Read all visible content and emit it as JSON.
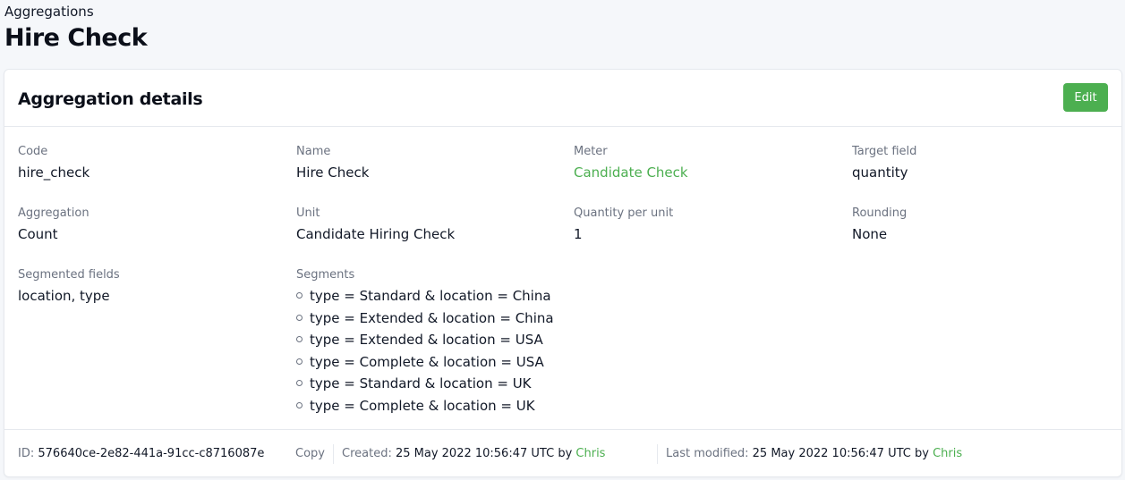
{
  "breadcrumb": "Aggregations",
  "page_title": "Hire Check",
  "card": {
    "title": "Aggregation details",
    "edit_label": "Edit"
  },
  "fields": {
    "code": {
      "label": "Code",
      "value": "hire_check"
    },
    "name": {
      "label": "Name",
      "value": "Hire Check"
    },
    "meter": {
      "label": "Meter",
      "value": "Candidate Check"
    },
    "target_field": {
      "label": "Target field",
      "value": "quantity"
    },
    "aggregation": {
      "label": "Aggregation",
      "value": "Count"
    },
    "unit": {
      "label": "Unit",
      "value": "Candidate Hiring Check"
    },
    "quantity_per_unit": {
      "label": "Quantity per unit",
      "value": "1"
    },
    "rounding": {
      "label": "Rounding",
      "value": "None"
    },
    "segmented_fields": {
      "label": "Segmented fields",
      "value": "location, type"
    },
    "segments": {
      "label": "Segments",
      "items": [
        "type = Standard & location = China",
        "type = Extended & location = China",
        "type = Extended & location = USA",
        "type = Complete & location = USA",
        "type = Standard & location = UK",
        "type = Complete & location = UK"
      ]
    }
  },
  "footer": {
    "id_label": "ID:",
    "id_value": "576640ce-2e82-441a-91cc-c8716087e",
    "copy_label": "Copy",
    "created_label": "Created:",
    "created_value": "25 May 2022 10:56:47 UTC",
    "created_by_word": "by",
    "created_by": "Chris",
    "modified_label": "Last modified:",
    "modified_value": "25 May 2022 10:56:47 UTC",
    "modified_by_word": "by",
    "modified_by": "Chris"
  },
  "colors": {
    "accent": "#4caf50",
    "muted_text": "#6b7280",
    "page_bg": "#f5f7fa"
  }
}
